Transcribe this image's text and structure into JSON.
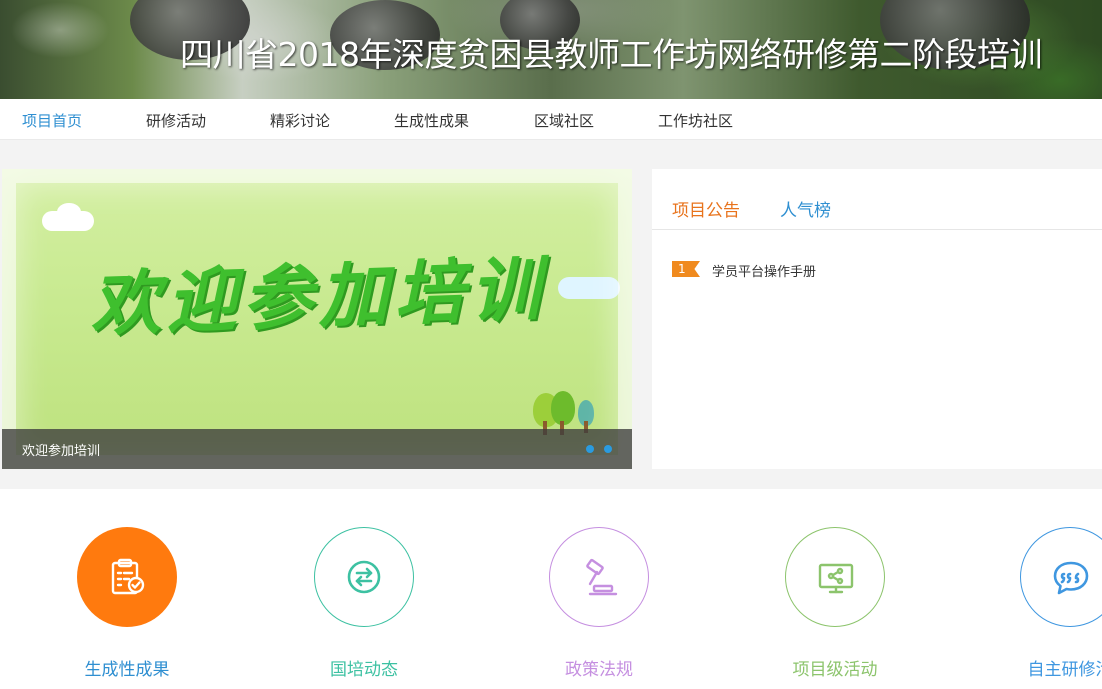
{
  "header": {
    "title": "四川省2018年深度贫困县教师工作坊网络研修第二阶段培训"
  },
  "nav": {
    "items": [
      {
        "label": "项目首页",
        "active": true
      },
      {
        "label": "研修活动",
        "active": false
      },
      {
        "label": "精彩讨论",
        "active": false
      },
      {
        "label": "生成性成果",
        "active": false
      },
      {
        "label": "区域社区",
        "active": false
      },
      {
        "label": "工作坊社区",
        "active": false
      }
    ]
  },
  "slider": {
    "slide_text": "欢迎参加培训",
    "caption": "欢迎参加培训",
    "dots": 2
  },
  "notice_panel": {
    "tabs": [
      {
        "label": "项目公告",
        "active": true
      },
      {
        "label": "人气榜",
        "active": false
      }
    ],
    "items": [
      {
        "rank": "1",
        "title": "学员平台操作手册"
      }
    ]
  },
  "features": [
    {
      "label": "生成性成果",
      "icon": "clipboard-check-icon",
      "color": "#ff7a0e",
      "filled": true
    },
    {
      "label": "国培动态",
      "icon": "refresh-arrows-icon",
      "color": "#3dc1a2",
      "filled": false
    },
    {
      "label": "政策法规",
      "icon": "gavel-icon",
      "color": "#c58fe0",
      "filled": false
    },
    {
      "label": "项目级活动",
      "icon": "monitor-share-icon",
      "color": "#8cc46c",
      "filled": false
    },
    {
      "label": "自主研修活",
      "icon": "chat-bubble-icon",
      "color": "#3f97e0",
      "filled": false
    }
  ],
  "colors": {
    "nav_active": "#2f8fd1",
    "tab_active": "#e8731c",
    "badge": "#f08a1e"
  }
}
